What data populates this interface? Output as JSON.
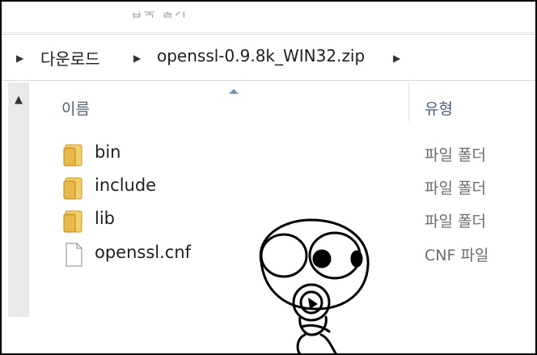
{
  "toolbar": {
    "partial_label": "압축 풀기"
  },
  "breadcrumb": {
    "items": [
      "다운로드",
      "openssl-0.9.8k_WIN32.zip"
    ]
  },
  "columns": {
    "name": "이름",
    "type": "유형"
  },
  "files": [
    {
      "name": "bin",
      "type": "파일 폴더",
      "icon": "folder-icon"
    },
    {
      "name": "include",
      "type": "파일 폴더",
      "icon": "folder-icon"
    },
    {
      "name": "lib",
      "type": "파일 폴더",
      "icon": "folder-icon"
    },
    {
      "name": "openssl.cnf",
      "type": "CNF 파일",
      "icon": "file-icon"
    }
  ],
  "colors": {
    "header_text": "#4c607a",
    "folder": "#e8b84a",
    "scrollbar": "#e9e9e9"
  }
}
